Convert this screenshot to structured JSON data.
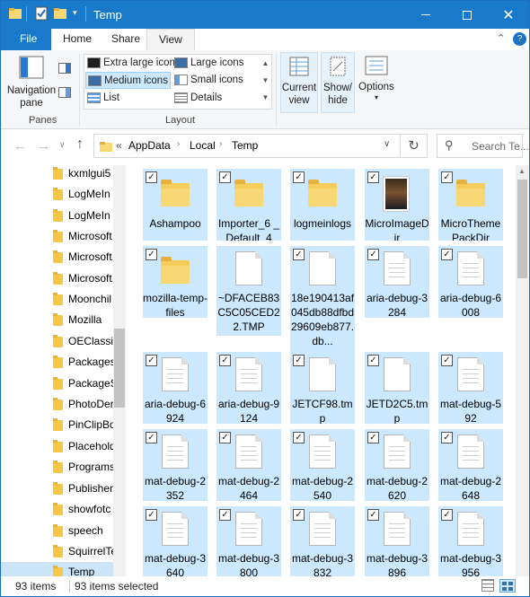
{
  "window": {
    "title": "Temp"
  },
  "ribbon_tabs": [
    {
      "label": "File"
    },
    {
      "label": "Home"
    },
    {
      "label": "Share"
    },
    {
      "label": "View"
    }
  ],
  "ribbon": {
    "navigation_pane": "Navigation pane",
    "panes_group": "Panes",
    "layout_options": [
      "Extra large icons",
      "Large icons",
      "Medium icons",
      "Small icons",
      "List",
      "Details"
    ],
    "layout_selected": "Medium icons",
    "layout_group": "Layout",
    "current_view": "Current view",
    "show_hide": "Show/ hide",
    "options": "Options"
  },
  "address": {
    "overflow": "«",
    "crumbs": [
      "AppData",
      "Local",
      "Temp"
    ],
    "search_placeholder": "Search Te..."
  },
  "nav_items": [
    {
      "label": "kxmlgui5"
    },
    {
      "label": "LogMeIn"
    },
    {
      "label": "LogMeIn"
    },
    {
      "label": "Microsoft"
    },
    {
      "label": "Microsoft"
    },
    {
      "label": "Microsoft"
    },
    {
      "label": "Moonchil"
    },
    {
      "label": "Mozilla"
    },
    {
      "label": "OEClassic"
    },
    {
      "label": "Packages"
    },
    {
      "label": "PackageS"
    },
    {
      "label": "PhotoDer"
    },
    {
      "label": "PinClipBo"
    },
    {
      "label": "Placehold"
    },
    {
      "label": "Programs"
    },
    {
      "label": "Publisher"
    },
    {
      "label": "showfotc"
    },
    {
      "label": "speech"
    },
    {
      "label": "SquirrelTe"
    },
    {
      "label": "Temp"
    }
  ],
  "files": [
    {
      "name": "Ashampoo",
      "type": "folder"
    },
    {
      "name": "Importer_6 _Default_4",
      "type": "folder"
    },
    {
      "name": "logmeinlogs",
      "type": "folder"
    },
    {
      "name": "MicroImageDir",
      "type": "photo"
    },
    {
      "name": "MicroThemePackDir",
      "type": "folder"
    },
    {
      "name": "mozilla-temp-files",
      "type": "folder"
    },
    {
      "name": "~DFACEB83C5C05CED22.TMP",
      "type": "file"
    },
    {
      "name": "18e190413af045db88dfbd29609eb877.db...",
      "type": "file"
    },
    {
      "name": "aria-debug-3284",
      "type": "doc"
    },
    {
      "name": "aria-debug-6008",
      "type": "doc"
    },
    {
      "name": "aria-debug-6924",
      "type": "doc"
    },
    {
      "name": "aria-debug-9124",
      "type": "doc"
    },
    {
      "name": "JETCF98.tmp",
      "type": "file"
    },
    {
      "name": "JETD2C5.tmp",
      "type": "file"
    },
    {
      "name": "mat-debug-592",
      "type": "doc"
    },
    {
      "name": "mat-debug-2352",
      "type": "doc"
    },
    {
      "name": "mat-debug-2464",
      "type": "doc"
    },
    {
      "name": "mat-debug-2540",
      "type": "doc"
    },
    {
      "name": "mat-debug-2620",
      "type": "doc"
    },
    {
      "name": "mat-debug-2648",
      "type": "doc"
    },
    {
      "name": "mat-debug-3640",
      "type": "doc"
    },
    {
      "name": "mat-debug-3800",
      "type": "doc"
    },
    {
      "name": "mat-debug-3832",
      "type": "doc"
    },
    {
      "name": "mat-debug-3896",
      "type": "doc"
    },
    {
      "name": "mat-debug-3956",
      "type": "doc"
    }
  ],
  "status": {
    "count": "93 items",
    "selected": "93 items selected"
  }
}
